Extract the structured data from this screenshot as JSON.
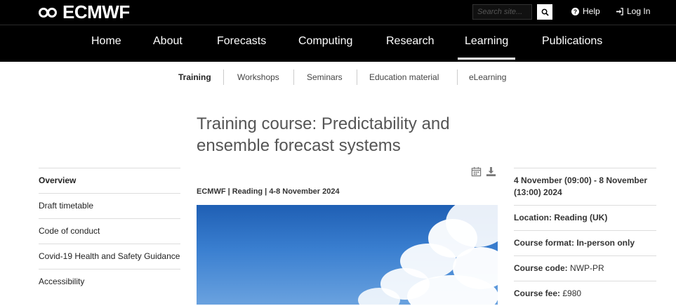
{
  "header": {
    "logo_text": "ECMWF",
    "search_placeholder": "Search site...",
    "help_label": "Help",
    "login_label": "Log In"
  },
  "main_nav": {
    "items": [
      {
        "label": "Home"
      },
      {
        "label": "About"
      },
      {
        "label": "Forecasts"
      },
      {
        "label": "Computing"
      },
      {
        "label": "Research"
      },
      {
        "label": "Learning",
        "active": true
      },
      {
        "label": "Publications"
      }
    ]
  },
  "sub_nav": {
    "items": [
      {
        "label": "Training",
        "active": true
      },
      {
        "label": "Workshops"
      },
      {
        "label": "Seminars"
      },
      {
        "label": "Education material"
      },
      {
        "label": "eLearning"
      }
    ]
  },
  "page": {
    "title": "Training course: Predictability and ensemble forecast systems",
    "meta": "ECMWF | Reading | 4-8 November 2024"
  },
  "sidebar": {
    "items": [
      {
        "label": "Overview",
        "active": true
      },
      {
        "label": "Draft timetable"
      },
      {
        "label": "Code of conduct"
      },
      {
        "label": "Covid-19 Health and Safety Guidance"
      },
      {
        "label": "Accessibility"
      }
    ]
  },
  "info": {
    "dates": "4 November (09:00) - 8 November (13:00) 2024",
    "location": "Location: Reading (UK)",
    "format": "Course format: In-person only",
    "code_label": "Course code:",
    "code_value": "NWP-PR",
    "fee_label": "Course fee:",
    "fee_value": "£980"
  },
  "icons": {
    "calendar": "calendar-icon",
    "download": "download-icon",
    "search": "search-icon",
    "help": "question-circle-icon",
    "login": "sign-in-icon"
  }
}
